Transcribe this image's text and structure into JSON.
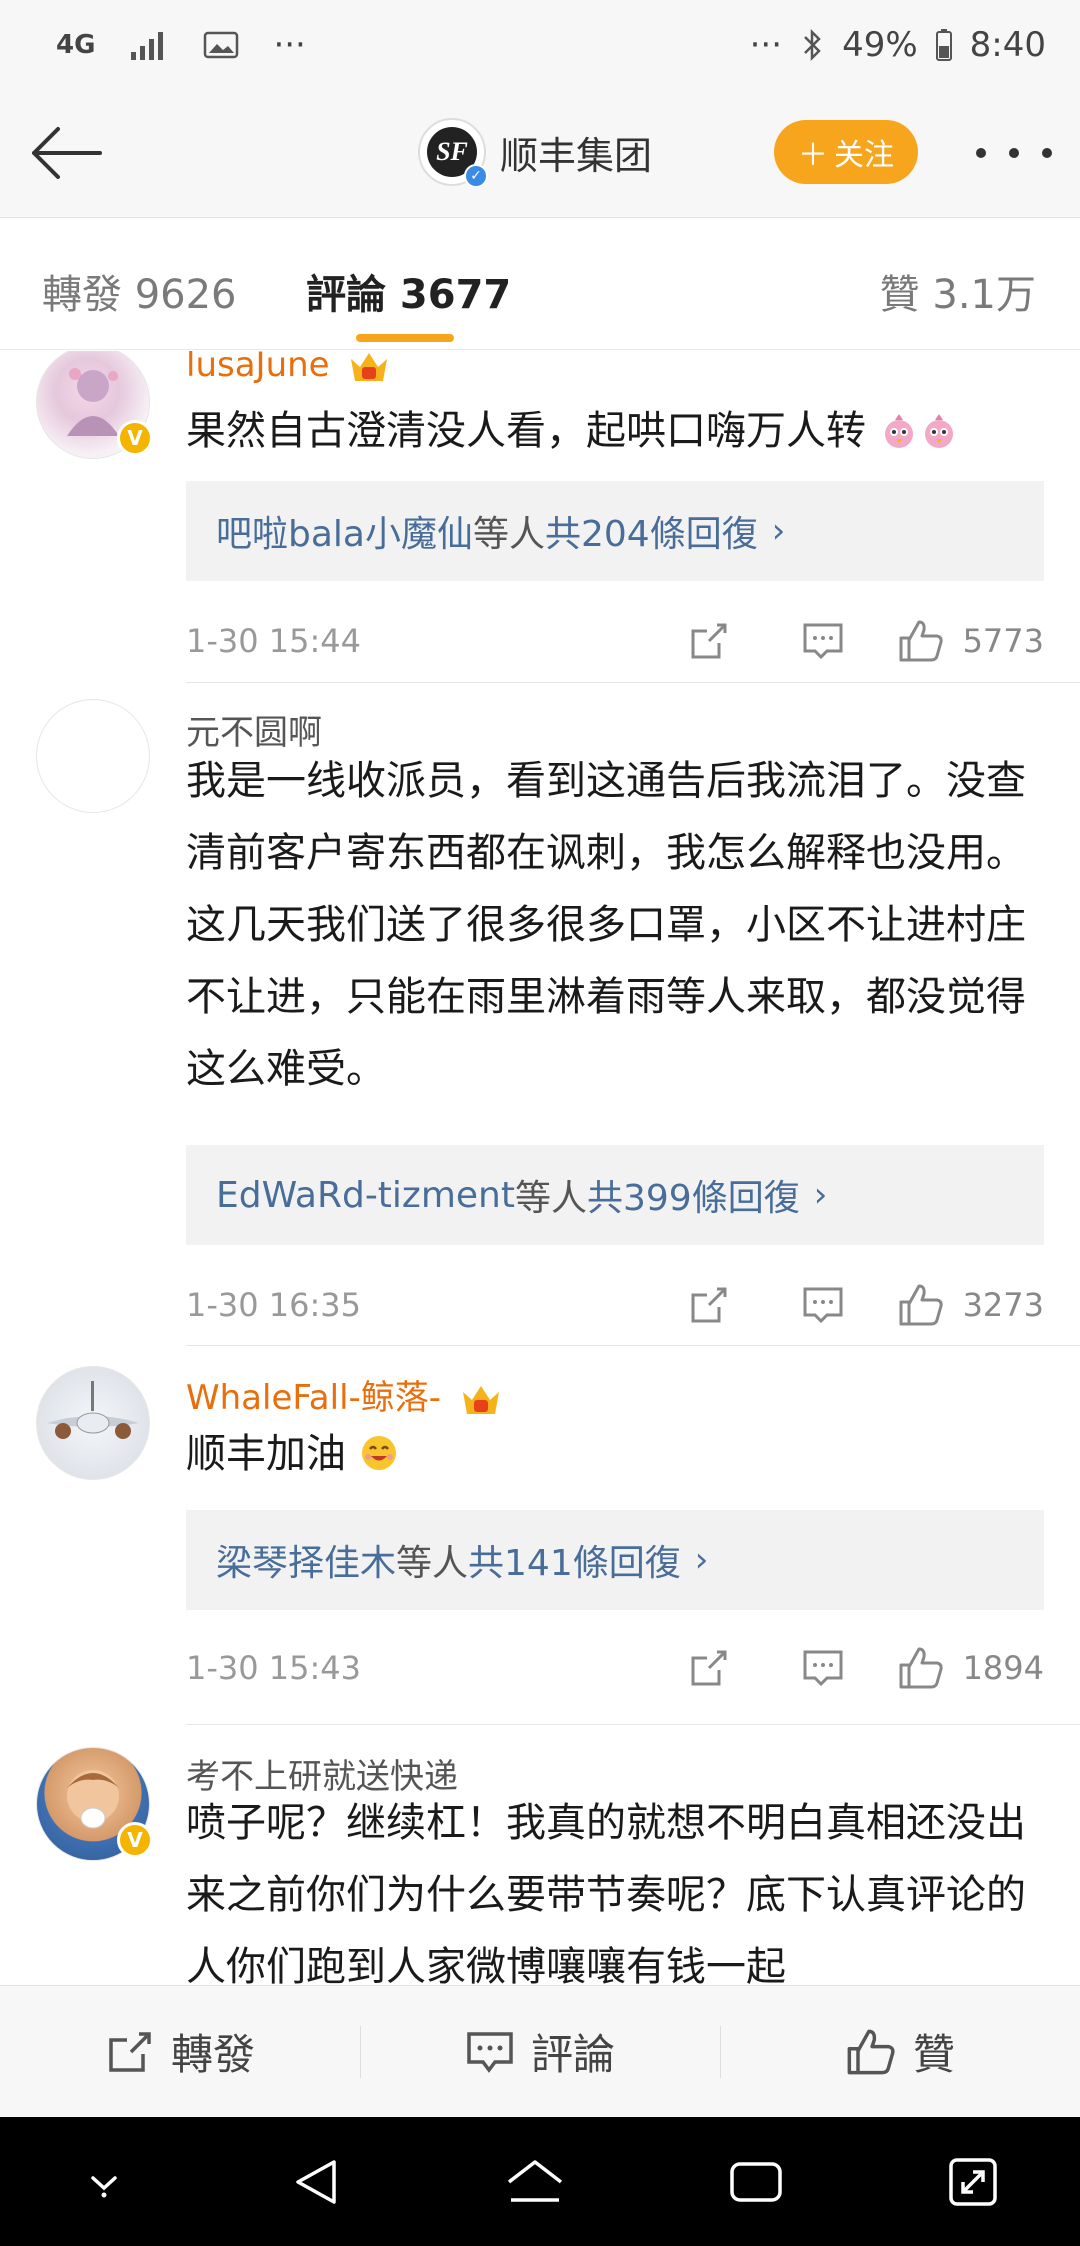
{
  "status_bar": {
    "network": "4G",
    "overflow_left": "···",
    "overflow_right": "···",
    "battery": "49%",
    "time": "8:40"
  },
  "header": {
    "brand_name": "顺丰集团",
    "follow_label": "关注",
    "follow_plus": "＋"
  },
  "tabs": {
    "repost": "轉發 9626",
    "comments": "評論 3677",
    "likes": "贊 3.1万"
  },
  "comments": [
    {
      "username": "lusaJune",
      "content": "果然自古澄清没人看，起哄口嗨万人转",
      "reply_users": "吧啦bala小魔仙",
      "reply_mid": "等人 ",
      "reply_count": "共204條回復",
      "time": "1-30 15:44",
      "likes": "5773"
    },
    {
      "username": "元不圆啊",
      "content": "我是一线收派员，看到这通告后我流泪了。没查清前客户寄东西都在讽刺，我怎么解释也没用。这几天我们送了很多很多口罩，小区不让进村庄不让进，只能在雨里淋着雨等人来取，都没觉得这么难受。",
      "reply_users": "EdWaRd-tizment",
      "reply_mid": "等人 ",
      "reply_count": "共399條回復",
      "time": "1-30 16:35",
      "likes": "3273"
    },
    {
      "username": "WhaleFall-鲸落-",
      "content": "顺丰加油",
      "reply_users": "梁琴择佳木",
      "reply_mid": "等人 ",
      "reply_count": "共141條回復",
      "time": "1-30 15:43",
      "likes": "1894"
    },
    {
      "username": "考不上研就送快递",
      "content": "喷子呢？继续杠！我真的就想不明白真相还没出来之前你们为什么要带节奏呢？底下认真评论的人你们跑到人家微博嚷嚷有钱一起"
    }
  ],
  "bottom_bar": {
    "repost": "轉發",
    "comment": "評論",
    "like": "贊"
  },
  "colors": {
    "accent": "#f7a51c",
    "vip_name": "#e86f0c",
    "link": "#496d99"
  }
}
